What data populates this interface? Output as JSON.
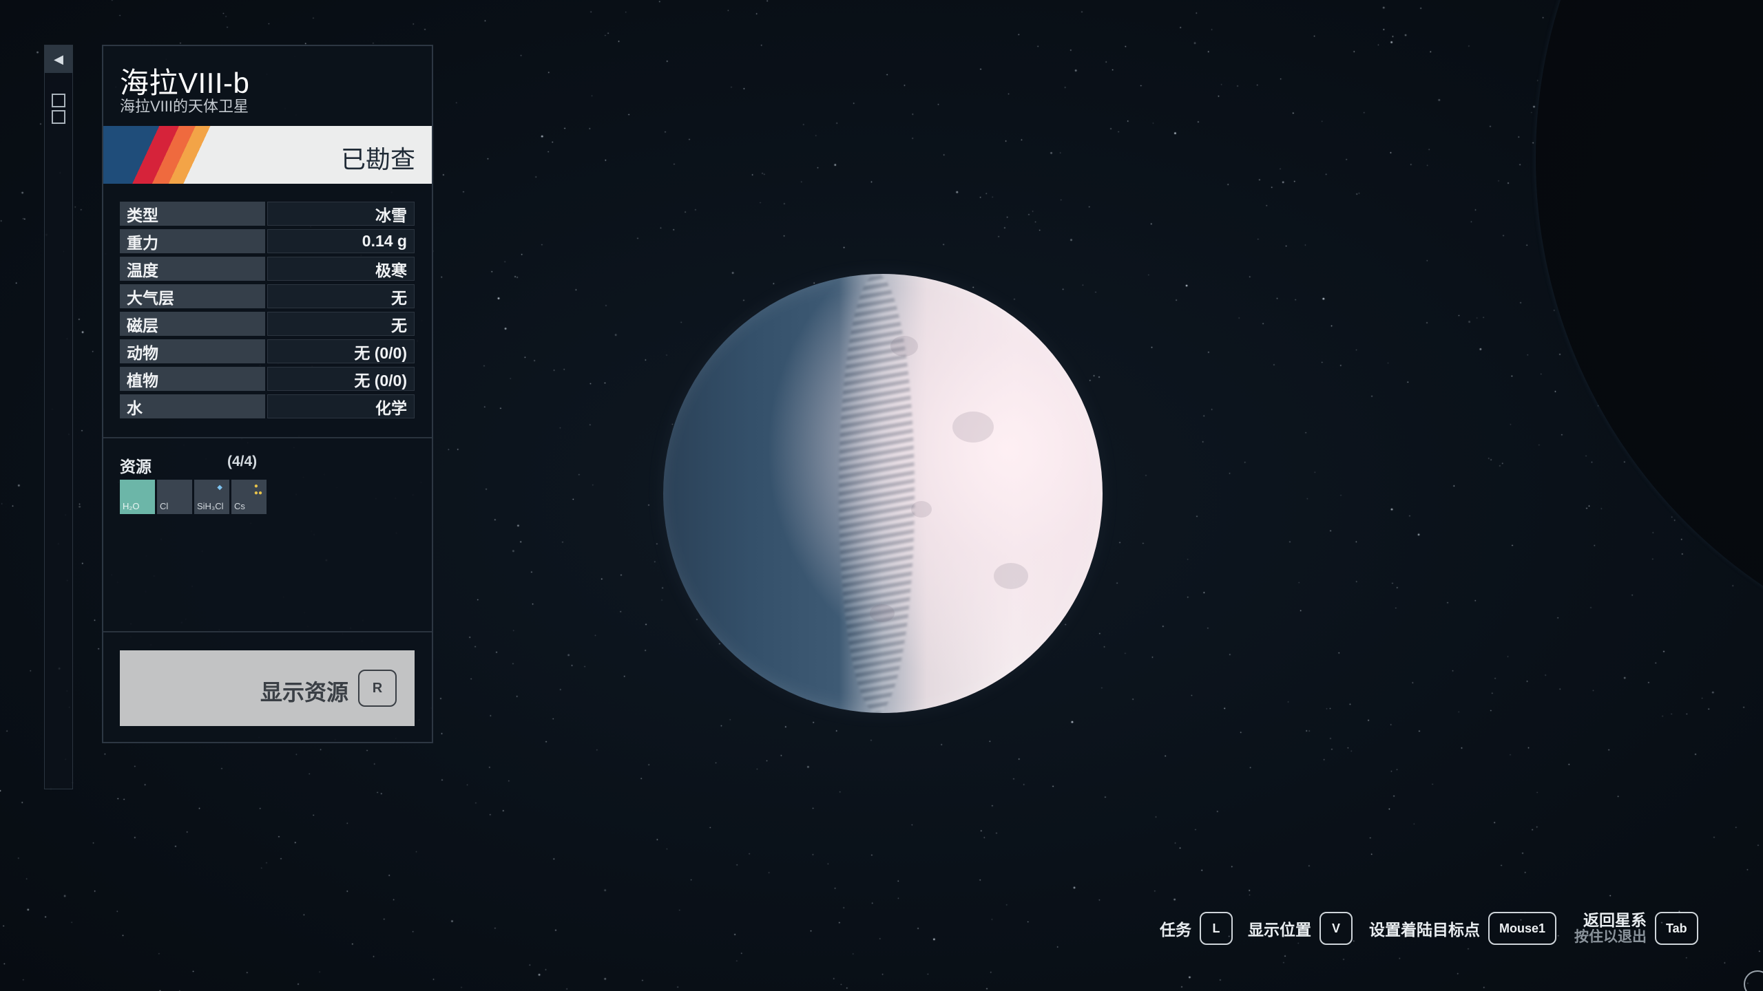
{
  "body": {
    "name": "海拉VIII-b",
    "subtitle": "海拉VIII的天体卫星",
    "status": "已勘查"
  },
  "properties": [
    {
      "key": "类型",
      "value": "冰雪"
    },
    {
      "key": "重力",
      "value": "0.14 g"
    },
    {
      "key": "温度",
      "value": "极寒"
    },
    {
      "key": "大气层",
      "value": "无"
    },
    {
      "key": "磁层",
      "value": "无"
    },
    {
      "key": "动物",
      "value": "无 (0/0)"
    },
    {
      "key": "植物",
      "value": "无 (0/0)"
    },
    {
      "key": "水",
      "value": "化学"
    }
  ],
  "resources": {
    "label": "资源",
    "count": "(4/4)",
    "items": [
      {
        "symbol": "H₂O",
        "highlight": true
      },
      {
        "symbol": "Cl",
        "highlight": false
      },
      {
        "symbol": "SiH₃Cl",
        "highlight": false
      },
      {
        "symbol": "Cs",
        "highlight": false
      }
    ]
  },
  "show_resources": {
    "label": "显示资源",
    "key": "R"
  },
  "hotkeys": [
    {
      "label": "任务",
      "key": "L"
    },
    {
      "label": "显示位置",
      "key": "V"
    },
    {
      "label": "设置着陆目标点",
      "key": "Mouse1"
    },
    {
      "label": "返回星系",
      "sub": "按住以退出",
      "key": "Tab"
    }
  ],
  "colors": {
    "accent_blue": "#1f4d7a",
    "accent_red": "#d6233a",
    "accent_orange": "#ef6a3e",
    "accent_yellow": "#f3a447",
    "resource_highlight": "#6cb6a8"
  }
}
